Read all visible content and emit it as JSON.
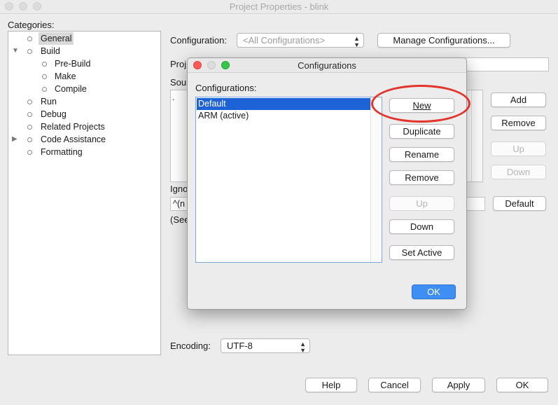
{
  "window": {
    "title": "Project Properties - blink"
  },
  "categories": {
    "label": "Categories:",
    "items": [
      {
        "label": "General"
      },
      {
        "label": "Build"
      },
      {
        "label": "Pre-Build"
      },
      {
        "label": "Make"
      },
      {
        "label": "Compile"
      },
      {
        "label": "Run"
      },
      {
        "label": "Debug"
      },
      {
        "label": "Related Projects"
      },
      {
        "label": "Code Assistance"
      },
      {
        "label": "Formatting"
      }
    ]
  },
  "main": {
    "configuration_label": "Configuration:",
    "configuration_value": "<All Configurations>",
    "manage_button": "Manage Configurations...",
    "project_label_partial": "Proj",
    "source_label_partial": "Sou",
    "source_row_partial": ".",
    "add_button": "Add",
    "remove_button": "Remove",
    "up_button": "Up",
    "down_button": "Down",
    "ignore_label_partial": "Igno",
    "ignore_value_partial": "^(n",
    "see_label_partial": "(See",
    "default_button": "Default",
    "encoding_label": "Encoding:",
    "encoding_value": "UTF-8"
  },
  "footer": {
    "help": "Help",
    "cancel": "Cancel",
    "apply": "Apply",
    "ok": "OK"
  },
  "dialog": {
    "title": "Configurations",
    "list_label": "Configurations:",
    "configs": [
      {
        "name": "Default"
      },
      {
        "name": "ARM (active)"
      }
    ],
    "buttons": {
      "new": "New",
      "duplicate": "Duplicate",
      "rename": "Rename",
      "remove": "Remove",
      "up": "Up",
      "down": "Down",
      "set_active": "Set Active",
      "ok": "OK"
    }
  },
  "colors": {
    "selection": "#1d62d6",
    "primary_button": "#3f8ef3",
    "highlight_ring": "#e3352c"
  }
}
